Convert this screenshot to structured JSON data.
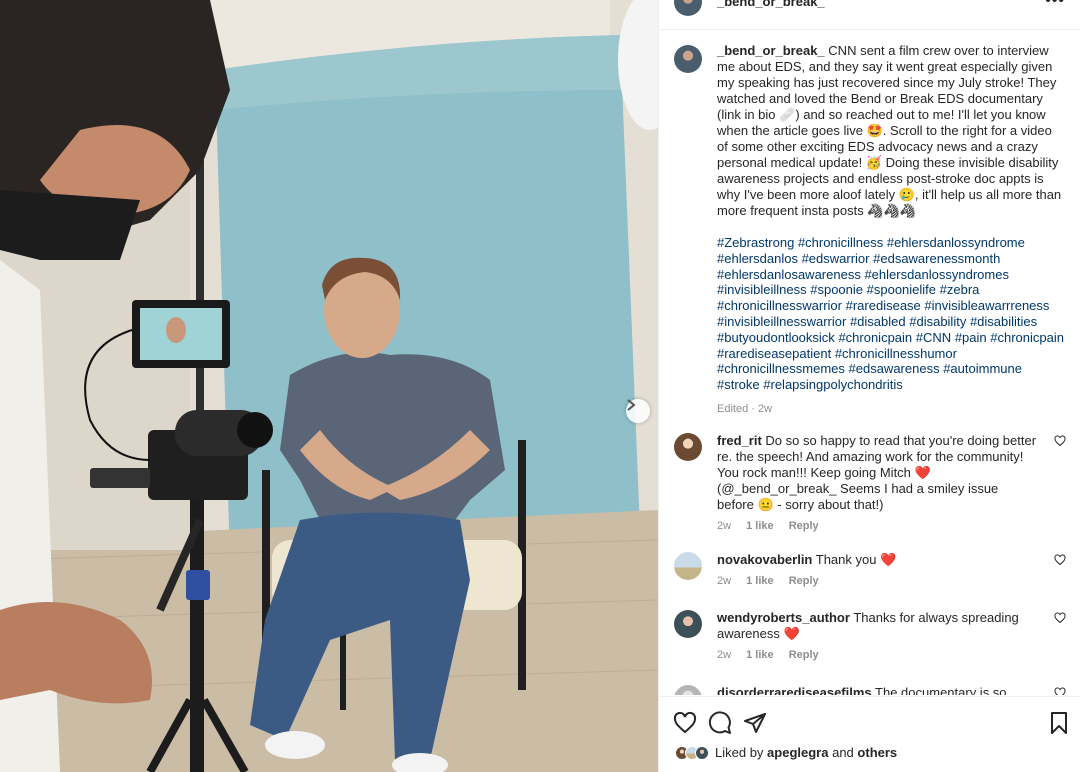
{
  "post": {
    "username": "_bend_or_break_",
    "more_icon": "more-horizontal-icon",
    "caption_text": "CNN sent a film crew over to interview me about EDS, and they say it went great especially given my speaking has just recovered since my July stroke! They watched and loved the Bend or Break EDS documentary (link in bio 🩹) and so reached out to me! I'll let you know when the article goes live 🤩. Scroll to the right for a video of some other exciting EDS advocacy news and a crazy personal medical update! 🥳 Doing these invisible disability awareness projects and endless post-stroke doc appts is why I've been more aloof lately 🥲, it'll help us all more than more frequent insta posts 🦓🦓🦓",
    "hashtags": [
      "#Zebrastrong",
      "#chronicillness",
      "#ehlersdanlossyndrome",
      "#ehlersdanlos",
      "#edswarrior",
      "#edsawarenessmonth",
      "#ehlersdanlosawareness",
      "#ehlersdanlossyndromes",
      "#invisibleillness",
      "#spoonie",
      "#spoonielife",
      "#zebra",
      "#chronicillnesswarrior",
      "#raredisease",
      "#invisibleawarrreness",
      "#invisibleillnesswarrior",
      "#disabled",
      "#disability",
      "#disabilities",
      "#butyoudontlooksick",
      "#chronicpain",
      "#CNN",
      "#pain",
      "#chronicpain",
      "#rarediseasepatient",
      "#chronicillnesshumor",
      "#chronicillnessmemes",
      "#edsawareness",
      "#autoimmune",
      "#stroke",
      "#relapsingpolychondritis"
    ],
    "edited_label": "Edited",
    "edited_time": "2w"
  },
  "comments": [
    {
      "username": "fred_rit",
      "text_before_heart": "Do so so happy to read that you're doing better re. the speech! And amazing work for the community! You rock man!!! Keep going Mitch",
      "heart": "❤️",
      "text_after_heart": "(@_bend_or_break_ Seems I had a smiley issue before 😐 - sorry about that!)",
      "time": "2w",
      "likes": "1 like",
      "reply": "Reply"
    },
    {
      "username": "novakovaberlin",
      "text_before_heart": "Thank you",
      "heart": "❤️",
      "text_after_heart": "",
      "time": "2w",
      "likes": "1 like",
      "reply": "Reply"
    },
    {
      "username": "wendyroberts_author",
      "text_before_heart": "Thanks for always spreading awareness",
      "heart": "❤️",
      "text_after_heart": "",
      "time": "2w",
      "likes": "1 like",
      "reply": "Reply"
    },
    {
      "username": "disorderrarediseasefilms",
      "text_before_heart": "The documentary is so powerful",
      "heart": "",
      "text_after_heart": "",
      "time": "",
      "likes": "",
      "reply": ""
    }
  ],
  "actions": {
    "like_icon": "heart-icon",
    "comment_icon": "comment-icon",
    "share_icon": "share-icon",
    "save_icon": "bookmark-icon",
    "liked_by_prefix": "Liked by",
    "liked_by_user": "apeglegra",
    "liked_by_and": "and",
    "liked_by_others": "others"
  },
  "photo": {
    "next_icon": "chevron-right-icon"
  }
}
